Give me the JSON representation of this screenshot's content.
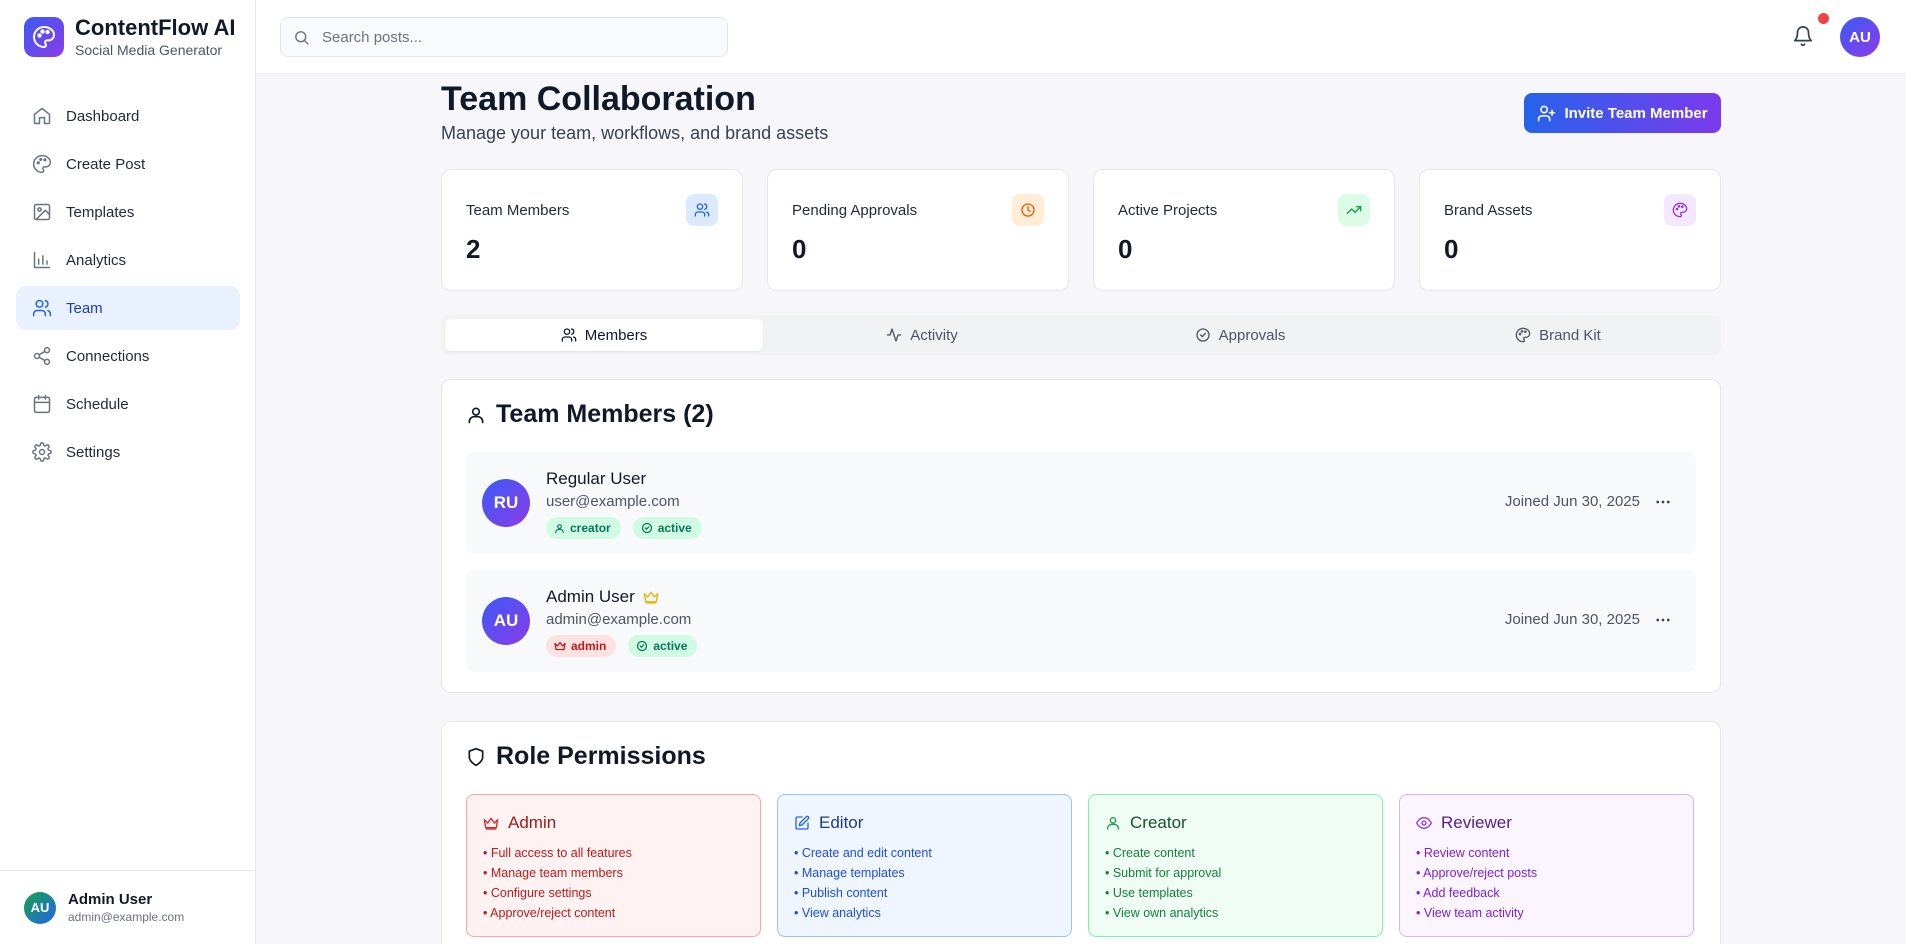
{
  "app": {
    "name": "ContentFlow AI",
    "subtitle": "Social Media Generator",
    "logo_icon": "palette-icon",
    "brand_gradient": [
      "#3b5bf6",
      "#8b3be8"
    ]
  },
  "sidebar": {
    "items": [
      {
        "label": "Dashboard",
        "icon": "home-icon"
      },
      {
        "label": "Create Post",
        "icon": "palette-icon"
      },
      {
        "label": "Templates",
        "icon": "image-icon"
      },
      {
        "label": "Analytics",
        "icon": "bar-chart-icon"
      },
      {
        "label": "Team",
        "icon": "users-icon",
        "active": true
      },
      {
        "label": "Connections",
        "icon": "share-icon"
      },
      {
        "label": "Schedule",
        "icon": "calendar-icon"
      },
      {
        "label": "Settings",
        "icon": "gear-icon"
      }
    ],
    "user": {
      "initials": "AU",
      "name": "Admin User",
      "email": "admin@example.com"
    }
  },
  "header": {
    "search_placeholder": "Search posts...",
    "search_value": "",
    "has_notification": true,
    "avatar_initials": "AU"
  },
  "page": {
    "title": "Team Collaboration",
    "subtitle": "Manage your team, workflows, and brand assets",
    "invite_label": "Invite Team Member"
  },
  "stats": [
    {
      "label": "Team Members",
      "value": "2",
      "icon": "users-icon",
      "color": "#2563eb",
      "bg": "#dbeafe"
    },
    {
      "label": "Pending Approvals",
      "value": "0",
      "icon": "clock-icon",
      "color": "#ea580c",
      "bg": "#ffedd5"
    },
    {
      "label": "Active Projects",
      "value": "0",
      "icon": "trending-up-icon",
      "color": "#16a34a",
      "bg": "#dcfce7"
    },
    {
      "label": "Brand Assets",
      "value": "0",
      "icon": "palette-icon",
      "color": "#9333ea",
      "bg": "#f3e8ff"
    }
  ],
  "tabs": [
    {
      "label": "Members",
      "icon": "users-icon",
      "active": true
    },
    {
      "label": "Activity",
      "icon": "activity-icon"
    },
    {
      "label": "Approvals",
      "icon": "check-circle-icon"
    },
    {
      "label": "Brand Kit",
      "icon": "palette-icon"
    }
  ],
  "members_section": {
    "title": "Team Members (2)",
    "members": [
      {
        "initials": "RU",
        "name": "Regular User",
        "email": "user@example.com",
        "role": "creator",
        "status": "active",
        "joined": "Joined Jun 30, 2025",
        "is_admin": false
      },
      {
        "initials": "AU",
        "name": "Admin User",
        "email": "admin@example.com",
        "role": "admin",
        "status": "active",
        "joined": "Joined Jun 30, 2025",
        "is_admin": true
      }
    ]
  },
  "roles_section": {
    "title": "Role Permissions",
    "roles": [
      {
        "name": "Admin",
        "icon": "crown-icon",
        "permissions": [
          "• Full access to all features",
          "• Manage team members",
          "• Configure settings",
          "• Approve/reject content"
        ]
      },
      {
        "name": "Editor",
        "icon": "edit-icon",
        "permissions": [
          "• Create and edit content",
          "• Manage templates",
          "• Publish content",
          "• View analytics"
        ]
      },
      {
        "name": "Creator",
        "icon": "user-icon",
        "permissions": [
          "• Create content",
          "• Submit for approval",
          "• Use templates",
          "• View own analytics"
        ]
      },
      {
        "name": "Reviewer",
        "icon": "eye-icon",
        "permissions": [
          "• Review content",
          "• Approve/reject posts",
          "• Add feedback",
          "• View team activity"
        ]
      }
    ]
  }
}
